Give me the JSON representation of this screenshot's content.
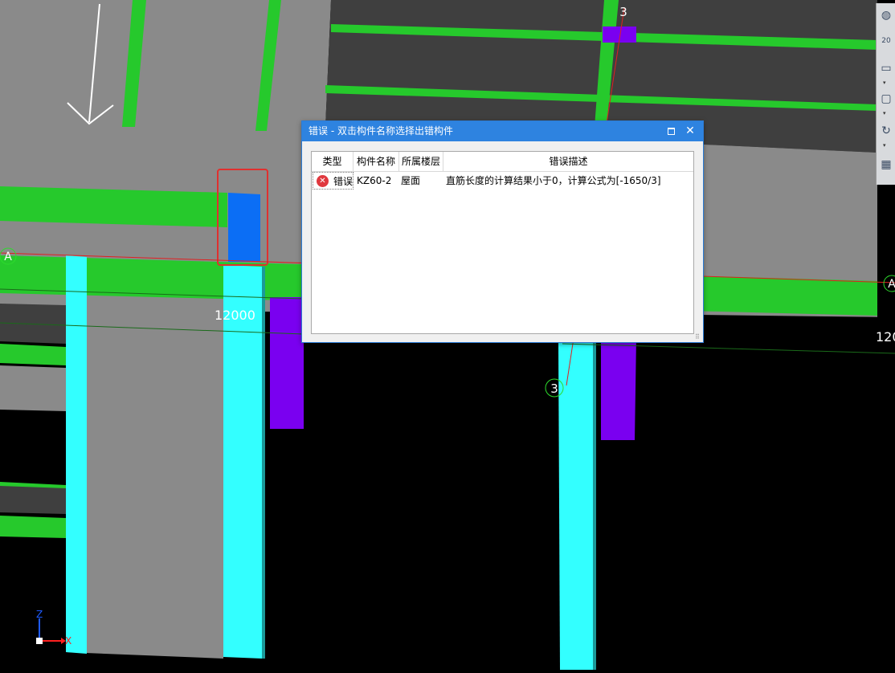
{
  "viewport": {
    "dim_label_left": "12000",
    "dim_label_right": "120",
    "axis_bubble_top": "3",
    "axis_bubble_mid": "3",
    "axis_bubble_left": "A",
    "axis_bubble_right": "A",
    "triad": {
      "x_label": "X",
      "z_label": "Z"
    },
    "colors": {
      "background": "#000000",
      "slab": "#8a8a8a",
      "beam": "#26c92c",
      "column": "#33ffff",
      "purple_column": "#7a00f0",
      "highlight_column": "#0b6ef5",
      "error_box": "#e0302f",
      "axis_line": "#e02020"
    }
  },
  "dialog": {
    "title": "错误 - 双击构件名称选择出错构件",
    "maximize_icon": "maximize-icon",
    "close_icon": "close-icon",
    "columns": [
      "类型",
      "构件名称",
      "所属楼层",
      "错误描述"
    ],
    "rows": [
      {
        "type_icon": "error-icon",
        "type": "错误",
        "name": "KZ60-2",
        "floor": "屋面",
        "desc": "直筋长度的计算结果小于0，计算公式为[-1650/3]"
      }
    ]
  },
  "toolbar": {
    "icons": [
      "globe-icon",
      "zoom-2d-icon",
      "box-view-icon",
      "cube-view-icon",
      "rotate-icon",
      "grid-icon"
    ],
    "zoom_label": "20"
  }
}
